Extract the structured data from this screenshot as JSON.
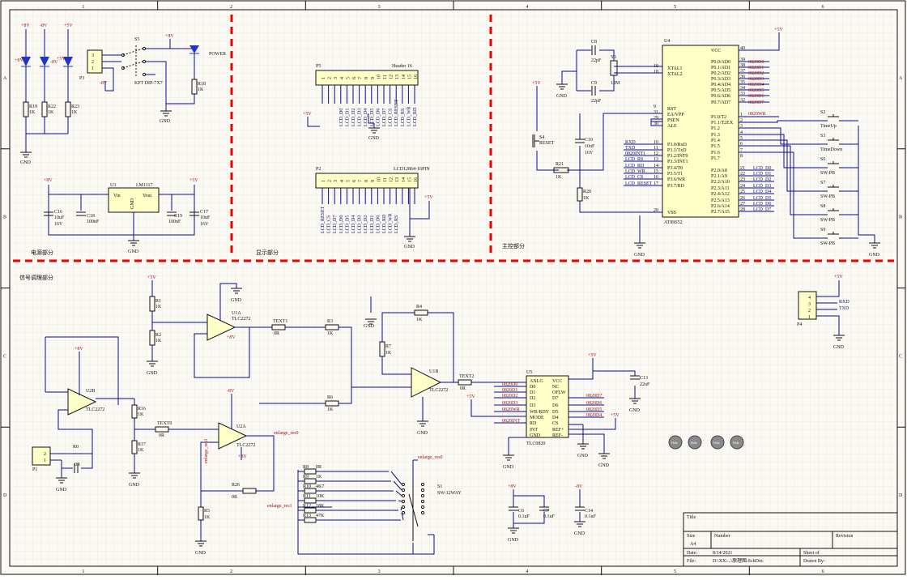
{
  "border": {
    "columns": [
      "1",
      "2",
      "3",
      "4",
      "5",
      "6"
    ],
    "rows": [
      "A",
      "B",
      "C",
      "D"
    ]
  },
  "sections": {
    "power": "电源部分",
    "display": "显示部分",
    "main": "主控部分",
    "signal": "信号调理部分"
  },
  "title_block": {
    "title_label": "Title",
    "size_label": "Size",
    "size_value": "A4",
    "number_label": "Number",
    "revision_label": "Revision",
    "date_label": "Date:",
    "date_value": "8/14/2021",
    "file_label": "File:",
    "file_value": "D:\\XX\\...\\原理图.SchDoc",
    "sheet_label": "Sheet    of",
    "drawn_label": "Drawn By:"
  },
  "power_labels": {
    "p8v": "+8V",
    "m8v": "-8V",
    "p5v": "+5V",
    "gnd": "GND"
  },
  "components": {
    "P3": "P3",
    "S5": "S5",
    "S5_value": "KFT DIP-7X7",
    "POWER": "POWER",
    "R18": "R18",
    "R19": "R19",
    "R22": "R22",
    "R23": "R23",
    "k1": "1K",
    "U3": "U3",
    "U3_value": "LM1117",
    "U3_vin": "Vin",
    "U3_vout": "Vout",
    "U3_gnd": "GND",
    "C16": "C16",
    "C18": "C18",
    "C19": "C19",
    "C17": "C17",
    "c10uf": "10uF",
    "c100nf": "100nF",
    "c16v": "16V",
    "P5": "P5",
    "P5_value": "Header 16",
    "P2": "P2",
    "P2_value": "LCD12864-16PIN",
    "U4": "U4",
    "U4_value": "AT89S52",
    "C8": "C8",
    "C9": "C9",
    "c22pf": "22pF",
    "Y1": "Y1",
    "Y1_value": "12M",
    "S4": "S4",
    "S4_value": "RESET",
    "C10": "C10",
    "R21": "R21",
    "R20": "R20",
    "S2": "S2",
    "S2_value": "TimeUp",
    "S3": "S3",
    "S3_value": "TimeDown",
    "S6": "S6",
    "S7": "S7",
    "S8": "S8",
    "S9": "S9",
    "swpb": "SW-PB",
    "P4": "P4",
    "R1": "R1",
    "R2": "R2",
    "U1A": "U1A",
    "U1B": "U1B",
    "U2A": "U2A",
    "U2B": "U2B",
    "opamp": "TLC2272",
    "TEXT1": "TEXT1",
    "TEXT0": "TEXT0",
    "TEXT2": "TEXT2",
    "r0r": "0R",
    "R3": "R3",
    "R4": "R4",
    "R5": "R5",
    "R6": "R6",
    "R7": "R7",
    "R16": "R16",
    "R17": "R17",
    "R0": "R0",
    "R26": "R26",
    "P1": "P1",
    "R8": "R8",
    "R9": "R9",
    "R10": "R10",
    "R11": "R11",
    "R12": "R12",
    "R13": "R13",
    "r8r": "0R",
    "r1k": "1K",
    "r4k7": "4K7",
    "r10k": "10K",
    "r18k": "18K",
    "r47k": "47K",
    "S1": "S1",
    "S1_value": "SW-12WAY",
    "enlarge_res": "enlarge_res0",
    "enlarge_res1": "enlarge_res1",
    "U5": "U5",
    "U5_value": "TLC0820",
    "C13": "C13",
    "C13_value": "22uF",
    "C6": "C6",
    "C7": "C7",
    "C14": "C14",
    "c01uf": "0.1uF"
  },
  "u4_left_pins": [
    "XTAL1",
    "XTAL2",
    "RST",
    "EA/VPP",
    "PSEN",
    "ALE",
    "P3.0/RxD",
    "P3.1/TxD",
    "P3.2/INT0",
    "P3.3/INT1",
    "P3.4/T0",
    "P3.5/T1",
    "P3.6/WR",
    "P3.7/RD",
    "VSS"
  ],
  "u4_left_nums": [
    "19",
    "18",
    "9",
    "31",
    "29",
    "30",
    "10",
    "11",
    "12",
    "13",
    "14",
    "15",
    "16",
    "17",
    "20"
  ],
  "u4_right_pins": [
    "VCC",
    "P0.0/AD0",
    "P0.1/AD1",
    "P0.2/AD2",
    "P0.3/AD3",
    "P0.4/AD4",
    "P0.5/AD5",
    "P0.6/AD6",
    "P0.7/AD7",
    "P1.0/T2",
    "P1.1/T2EX",
    "P1.2",
    "P1.3",
    "P1.4",
    "P1.5",
    "P1.6",
    "P1.7",
    "P2.0/A8",
    "P2.1/A9",
    "P2.2/A10",
    "P2.3/A11",
    "P2.4/A12",
    "P2.5/A13",
    "P2.6/A14",
    "P2.7/A15"
  ],
  "u4_right_nums": [
    "40",
    "39",
    "38",
    "37",
    "36",
    "35",
    "34",
    "33",
    "32",
    "1",
    "2",
    "3",
    "4",
    "5",
    "6",
    "7",
    "8",
    "21",
    "22",
    "23",
    "24",
    "25",
    "26",
    "27",
    "28"
  ],
  "u4_p0_nets": [
    "0820D0",
    "0820D1",
    "0820D2",
    "0820D3",
    "0820D4",
    "0820D5",
    "0820D6",
    "0820D7"
  ],
  "u4_p1_nets": [
    "0820WR"
  ],
  "u4_p3_nets": [
    "RXD",
    "TXD",
    "0820INT1",
    "LCD_RS",
    "LCD_RD",
    "LCD_WR",
    "LCD_CS",
    "LCD_RESET"
  ],
  "u4_p2_nets": [
    "LCD_D0",
    "LCD_D1",
    "LCD_D2",
    "LCD_D3",
    "LCD_D4",
    "LCD_D5",
    "LCD_D6",
    "LCD_D7"
  ],
  "p5_pins": [
    "1",
    "2",
    "3",
    "4",
    "5",
    "6",
    "7",
    "8",
    "9",
    "10",
    "11",
    "12",
    "13",
    "14",
    "15",
    "16"
  ],
  "p5_nets": [
    "LCD_D0",
    "LCD_D1",
    "LCD_D2",
    "LCD_D3",
    "LCD_D4",
    "LCD_D5",
    "LCD_D6",
    "LCD_D7",
    "LCD_CS",
    "LCD_RESET",
    "LCD_RS",
    "LCD_WR",
    "LCD_RD"
  ],
  "p2_nets": [
    "LCD_RESET",
    "LCD_CS",
    "LCD_D7",
    "LCD_D6",
    "LCD_D5",
    "LCD_D4",
    "LCD_D3",
    "LCD_D2",
    "LCD_D1",
    "LCD_D0",
    "LCD_RD",
    "LCD_WR",
    "LCD_RS"
  ],
  "p4_nets": [
    "RXD",
    "TXD"
  ],
  "u5_left_pins": [
    "ANLG",
    "D0",
    "D1",
    "D2",
    "D3",
    "WR/RDY",
    "MODE",
    "RD",
    "INT",
    "GND"
  ],
  "u5_right_pins": [
    "VCC",
    "NC",
    "OFLW",
    "D7",
    "D6",
    "D5",
    "D4",
    "CS",
    "REF+",
    "REF-"
  ],
  "u5_left_nets": [
    "0820D0",
    "0820D1",
    "0820D2",
    "0820D3",
    "0820WR",
    "0820INT"
  ],
  "u5_right_nets": [
    "0820D7",
    "0820D6",
    "0820D5",
    "0820D4"
  ],
  "mount_holes": [
    "Hole",
    "Hole",
    "Hole",
    "Hole"
  ]
}
